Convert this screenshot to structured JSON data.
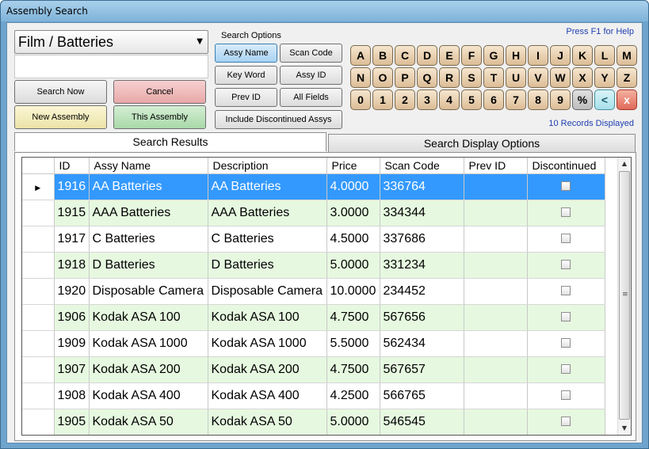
{
  "window": {
    "title": "Assembly Search"
  },
  "filter": {
    "selected": "Film / Batteries"
  },
  "buttons": {
    "search_now": "Search Now",
    "cancel": "Cancel",
    "new_assembly": "New Assembly",
    "this_assembly": "This Assembly"
  },
  "search_options": {
    "label": "Search Options",
    "assy_name": "Assy Name",
    "scan_code": "Scan Code",
    "key_word": "Key Word",
    "assy_id": "Assy ID",
    "prev_id": "Prev ID",
    "all_fields": "All Fields",
    "include_discontinued": "Include Discontinued Assys"
  },
  "help_text": "Press F1 for Help",
  "records_text": "10 Records Displayed",
  "keyboard": {
    "row1": [
      "A",
      "B",
      "C",
      "D",
      "E",
      "F",
      "G",
      "H",
      "I",
      "J",
      "K",
      "L",
      "M"
    ],
    "row2": [
      "N",
      "O",
      "P",
      "Q",
      "R",
      "S",
      "T",
      "U",
      "V",
      "W",
      "X",
      "Y",
      "Z"
    ],
    "row3": [
      "0",
      "1",
      "2",
      "3",
      "4",
      "5",
      "6",
      "7",
      "8",
      "9",
      "%",
      "<",
      "x"
    ]
  },
  "tabs": {
    "results": "Search Results",
    "display_options": "Search Display Options"
  },
  "table": {
    "columns": [
      "ID",
      "Assy Name",
      "Description",
      "Price",
      "Scan Code",
      "Prev ID",
      "Discontinued"
    ],
    "rows": [
      {
        "id": "1916",
        "name": "AA Batteries",
        "desc": "AA Batteries",
        "price": "4.0000",
        "scan": "336764",
        "prev": "",
        "disc": false
      },
      {
        "id": "1915",
        "name": "AAA Batteries",
        "desc": "AAA Batteries",
        "price": "3.0000",
        "scan": "334344",
        "prev": "",
        "disc": false
      },
      {
        "id": "1917",
        "name": "C Batteries",
        "desc": "C Batteries",
        "price": "4.5000",
        "scan": "337686",
        "prev": "",
        "disc": false
      },
      {
        "id": "1918",
        "name": "D Batteries",
        "desc": "D Batteries",
        "price": "5.0000",
        "scan": "331234",
        "prev": "",
        "disc": false
      },
      {
        "id": "1920",
        "name": "Disposable Camera",
        "desc": "Disposable Camera",
        "price": "10.0000",
        "scan": "234452",
        "prev": "",
        "disc": false
      },
      {
        "id": "1906",
        "name": "Kodak ASA 100",
        "desc": "Kodak ASA 100",
        "price": "4.7500",
        "scan": "567656",
        "prev": "",
        "disc": false
      },
      {
        "id": "1909",
        "name": "Kodak ASA 1000",
        "desc": "Kodak ASA 1000",
        "price": "5.5000",
        "scan": "562434",
        "prev": "",
        "disc": false
      },
      {
        "id": "1907",
        "name": "Kodak ASA 200",
        "desc": "Kodak ASA 200",
        "price": "4.7500",
        "scan": "567657",
        "prev": "",
        "disc": false
      },
      {
        "id": "1908",
        "name": "Kodak ASA 400",
        "desc": "Kodak ASA 400",
        "price": "4.2500",
        "scan": "566765",
        "prev": "",
        "disc": false
      },
      {
        "id": "1905",
        "name": "Kodak ASA 50",
        "desc": "Kodak ASA 50",
        "price": "5.0000",
        "scan": "546545",
        "prev": "",
        "disc": false
      }
    ]
  }
}
